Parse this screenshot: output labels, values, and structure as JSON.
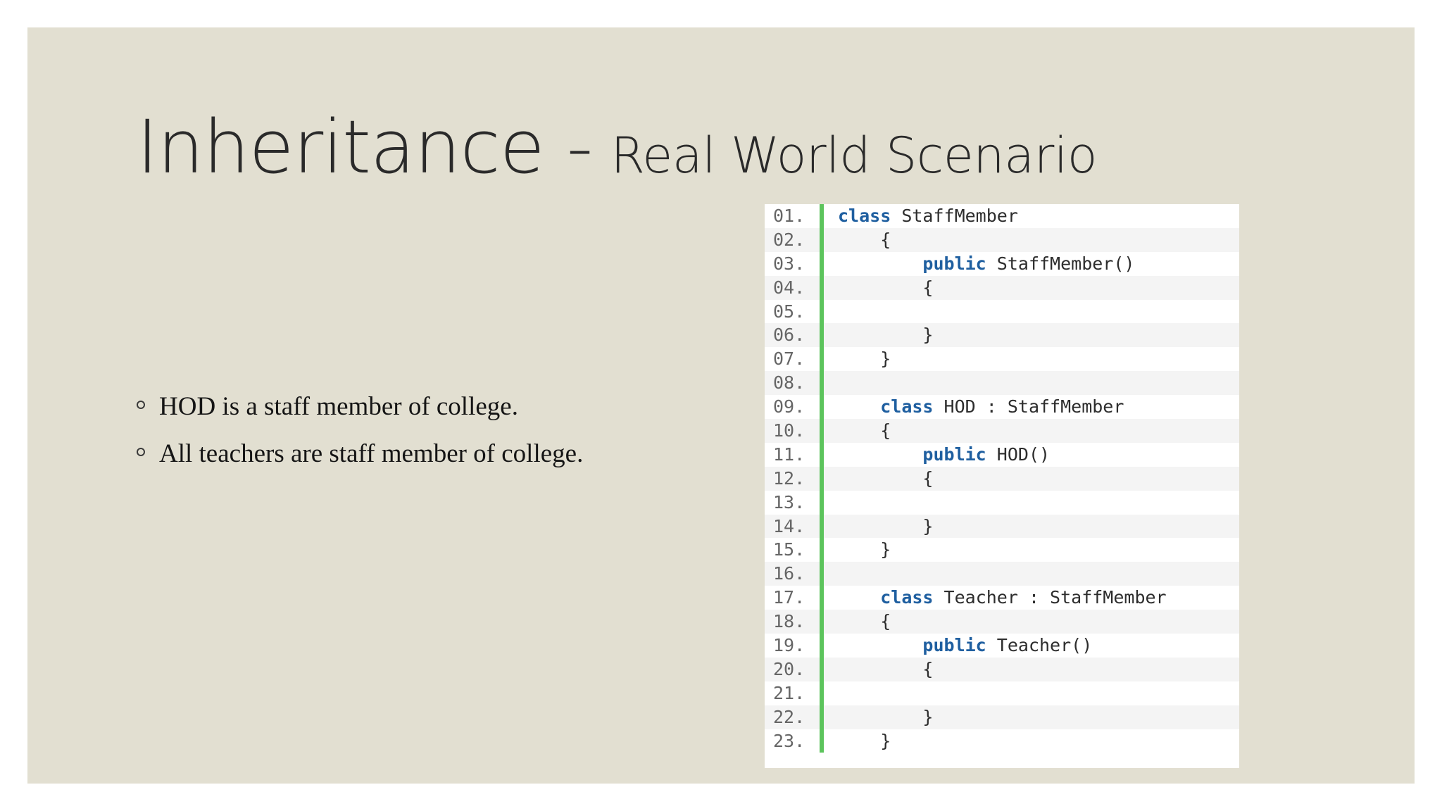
{
  "slide": {
    "title_main": "Inheritance -",
    "title_sub": "Real World Scenario",
    "bullets": [
      "HOD is a staff member of college.",
      "All teachers are staff member of college."
    ]
  },
  "code": {
    "lines": [
      {
        "no": "01.",
        "indent": "",
        "kw": "class",
        "text": " StaffMember"
      },
      {
        "no": "02.",
        "indent": "    ",
        "kw": "",
        "text": "{"
      },
      {
        "no": "03.",
        "indent": "        ",
        "kw": "public",
        "text": " StaffMember()"
      },
      {
        "no": "04.",
        "indent": "        ",
        "kw": "",
        "text": "{"
      },
      {
        "no": "05.",
        "indent": "",
        "kw": "",
        "text": ""
      },
      {
        "no": "06.",
        "indent": "        ",
        "kw": "",
        "text": "}"
      },
      {
        "no": "07.",
        "indent": "    ",
        "kw": "",
        "text": "}"
      },
      {
        "no": "08.",
        "indent": "",
        "kw": "",
        "text": ""
      },
      {
        "no": "09.",
        "indent": "    ",
        "kw": "class",
        "text": " HOD : StaffMember"
      },
      {
        "no": "10.",
        "indent": "    ",
        "kw": "",
        "text": "{"
      },
      {
        "no": "11.",
        "indent": "        ",
        "kw": "public",
        "text": " HOD()"
      },
      {
        "no": "12.",
        "indent": "        ",
        "kw": "",
        "text": "{"
      },
      {
        "no": "13.",
        "indent": "",
        "kw": "",
        "text": ""
      },
      {
        "no": "14.",
        "indent": "        ",
        "kw": "",
        "text": "}"
      },
      {
        "no": "15.",
        "indent": "    ",
        "kw": "",
        "text": "}"
      },
      {
        "no": "16.",
        "indent": "",
        "kw": "",
        "text": ""
      },
      {
        "no": "17.",
        "indent": "    ",
        "kw": "class",
        "text": " Teacher : StaffMember"
      },
      {
        "no": "18.",
        "indent": "    ",
        "kw": "",
        "text": "{"
      },
      {
        "no": "19.",
        "indent": "        ",
        "kw": "public",
        "text": " Teacher()"
      },
      {
        "no": "20.",
        "indent": "        ",
        "kw": "",
        "text": "{"
      },
      {
        "no": "21.",
        "indent": "",
        "kw": "",
        "text": ""
      },
      {
        "no": "22.",
        "indent": "        ",
        "kw": "",
        "text": "}"
      },
      {
        "no": "23.",
        "indent": "    ",
        "kw": "",
        "text": "}"
      }
    ]
  }
}
